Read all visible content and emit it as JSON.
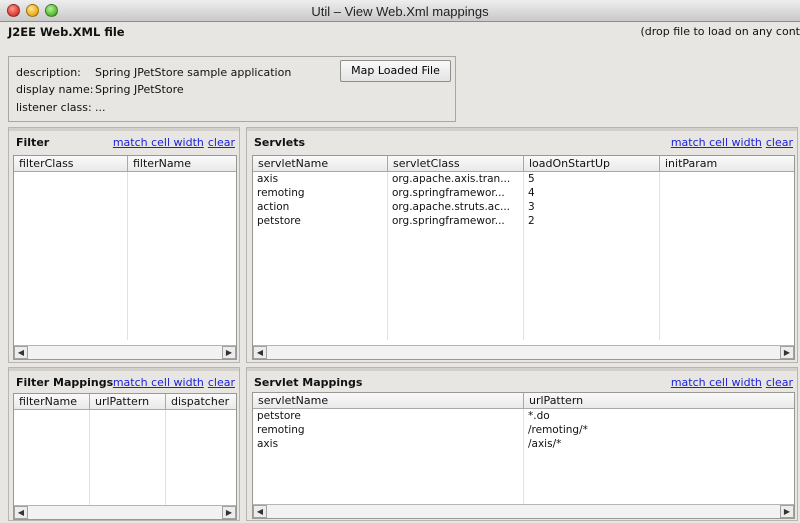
{
  "window": {
    "title": "Util – View Web.Xml mappings"
  },
  "heading": "J2EE Web.XML file",
  "drop_hint": "(drop file to load on any cont",
  "descriptor": {
    "description_label": "description:",
    "description_value": "Spring JPetStore sample application",
    "display_name_label": "display name:",
    "display_name_value": "Spring JPetStore",
    "listener_label": "listener class:",
    "listener_value": "...",
    "map_button": "Map Loaded File"
  },
  "link_labels": {
    "match": "match cell width",
    "clear": "clear"
  },
  "filter": {
    "title": "Filter",
    "columns": [
      "filterClass",
      "filterName"
    ],
    "rows": []
  },
  "filter_mappings": {
    "title": "Filter Mappings",
    "columns": [
      "filterName",
      "urlPattern",
      "dispatcher"
    ],
    "rows": []
  },
  "servlets": {
    "title": "Servlets",
    "columns": [
      "servletName",
      "servletClass",
      "loadOnStartUp",
      "initParam"
    ],
    "rows": [
      [
        "axis",
        "org.apache.axis.tran...",
        "5",
        ""
      ],
      [
        "remoting",
        "org.springframewor...",
        "4",
        ""
      ],
      [
        "action",
        "org.apache.struts.ac...",
        "3",
        ""
      ],
      [
        "petstore",
        "org.springframewor...",
        "2",
        ""
      ]
    ]
  },
  "servlet_mappings": {
    "title": "Servlet Mappings",
    "columns": [
      "servletName",
      "urlPattern"
    ],
    "rows": [
      [
        "petstore",
        "*.do"
      ],
      [
        "remoting",
        "/remoting/*"
      ],
      [
        "axis",
        "/axis/*"
      ]
    ]
  },
  "icons": {
    "close": "close-window-icon",
    "minimize": "minimize-window-icon",
    "zoom": "zoom-window-icon",
    "scroll_left": "scroll-left-arrow-icon",
    "scroll_right": "scroll-right-arrow-icon"
  },
  "colors": {
    "link": "#1b22d8",
    "window_bg": "#e8e6e2"
  }
}
